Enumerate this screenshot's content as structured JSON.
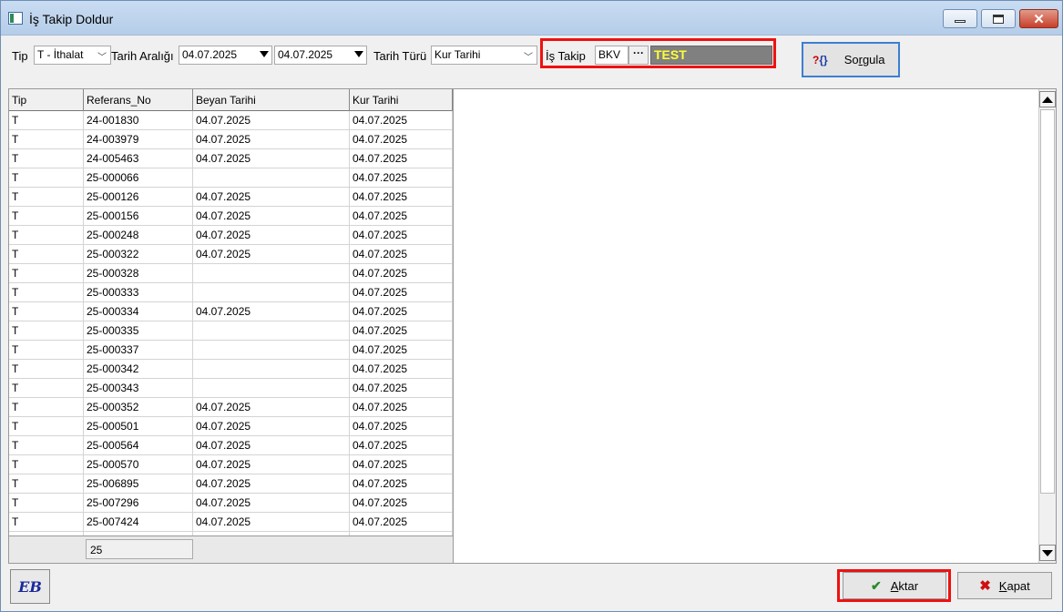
{
  "window": {
    "title": "İş Takip Doldur"
  },
  "filters": {
    "tip_label": "Tip",
    "tip_value": "T - İthalat",
    "tarih_araligi_label": "Tarih Aralığı",
    "date_from": "04.07.2025",
    "date_to": "04.07.2025",
    "tarih_turu_label": "Tarih Türü",
    "tarih_turu_value": "Kur Tarihi",
    "is_takip_label": "İş Takip",
    "is_takip_code": "BKV",
    "is_takip_lookup": "···",
    "is_takip_name": "TEST"
  },
  "buttons": {
    "sorgula_pre": "So",
    "sorgula_acc": "r",
    "sorgula_post": "gula",
    "aktar_acc": "A",
    "aktar_post": "ktar",
    "kapat_acc": "K",
    "kapat_post": "apat",
    "eb_label": "EB"
  },
  "grid": {
    "columns": [
      "Tip",
      "Referans_No",
      "Beyan Tarihi",
      "Kur Tarihi"
    ],
    "rows": [
      [
        "T",
        "24-001830",
        "04.07.2025",
        "04.07.2025"
      ],
      [
        "T",
        "24-003979",
        "04.07.2025",
        "04.07.2025"
      ],
      [
        "T",
        "24-005463",
        "04.07.2025",
        "04.07.2025"
      ],
      [
        "T",
        "25-000066",
        "",
        "04.07.2025"
      ],
      [
        "T",
        "25-000126",
        "04.07.2025",
        "04.07.2025"
      ],
      [
        "T",
        "25-000156",
        "04.07.2025",
        "04.07.2025"
      ],
      [
        "T",
        "25-000248",
        "04.07.2025",
        "04.07.2025"
      ],
      [
        "T",
        "25-000322",
        "04.07.2025",
        "04.07.2025"
      ],
      [
        "T",
        "25-000328",
        "",
        "04.07.2025"
      ],
      [
        "T",
        "25-000333",
        "",
        "04.07.2025"
      ],
      [
        "T",
        "25-000334",
        "04.07.2025",
        "04.07.2025"
      ],
      [
        "T",
        "25-000335",
        "",
        "04.07.2025"
      ],
      [
        "T",
        "25-000337",
        "",
        "04.07.2025"
      ],
      [
        "T",
        "25-000342",
        "",
        "04.07.2025"
      ],
      [
        "T",
        "25-000343",
        "",
        "04.07.2025"
      ],
      [
        "T",
        "25-000352",
        "04.07.2025",
        "04.07.2025"
      ],
      [
        "T",
        "25-000501",
        "04.07.2025",
        "04.07.2025"
      ],
      [
        "T",
        "25-000564",
        "04.07.2025",
        "04.07.2025"
      ],
      [
        "T",
        "25-000570",
        "04.07.2025",
        "04.07.2025"
      ],
      [
        "T",
        "25-006895",
        "04.07.2025",
        "04.07.2025"
      ],
      [
        "T",
        "25-007296",
        "04.07.2025",
        "04.07.2025"
      ],
      [
        "T",
        "25-007424",
        "04.07.2025",
        "04.07.2025"
      ]
    ],
    "footer_count": "25"
  },
  "colors": {
    "highlight": "#ee1111",
    "name_field_bg": "#808080",
    "name_field_text": "#ffff33"
  }
}
